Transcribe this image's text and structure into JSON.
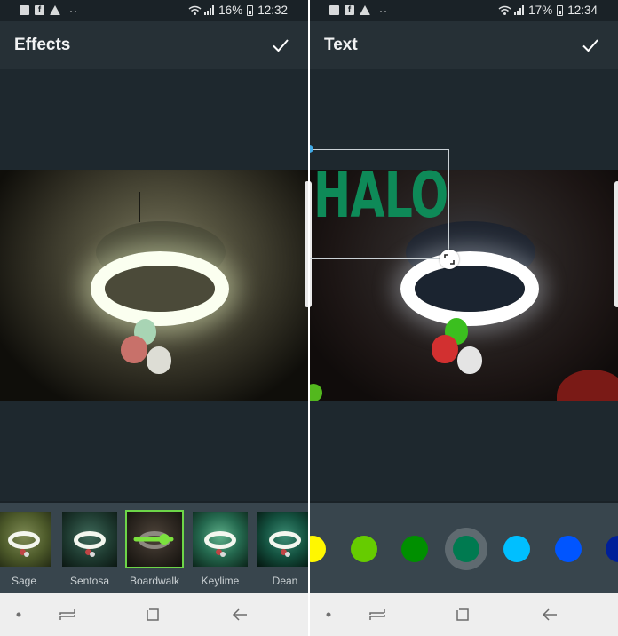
{
  "screens": [
    {
      "status_bar": {
        "battery_percent": "16%",
        "time": "12:32",
        "notification_icons": [
          "gallery-icon",
          "facebook-icon",
          "warning-icon",
          "more-dots-icon"
        ]
      },
      "app_bar": {
        "title": "Effects",
        "confirm_icon": "checkmark-icon"
      },
      "filters": {
        "selected": "Boardwalk",
        "selected_color": "#6dd548",
        "items": [
          {
            "label": "Sage"
          },
          {
            "label": "Sentosa"
          },
          {
            "label": "Boardwalk"
          },
          {
            "label": "Keylime"
          },
          {
            "label": "Dean"
          }
        ]
      }
    },
    {
      "status_bar": {
        "battery_percent": "17%",
        "time": "12:34",
        "notification_icons": [
          "gallery-icon",
          "facebook-icon",
          "warning-icon",
          "more-dots-icon"
        ]
      },
      "app_bar": {
        "title": "Text",
        "confirm_icon": "checkmark-icon"
      },
      "text_overlay": {
        "text": "HALO",
        "color": "#0e8a58"
      },
      "palette": {
        "selected_index": 3,
        "colors": [
          "#fff700",
          "#66cc00",
          "#008f00",
          "#007a50",
          "#00bfff",
          "#0055ff",
          "#001f99"
        ]
      }
    }
  ],
  "nav_bar": {
    "icons": [
      "dot-icon",
      "recents-icon",
      "home-icon",
      "back-icon"
    ]
  }
}
